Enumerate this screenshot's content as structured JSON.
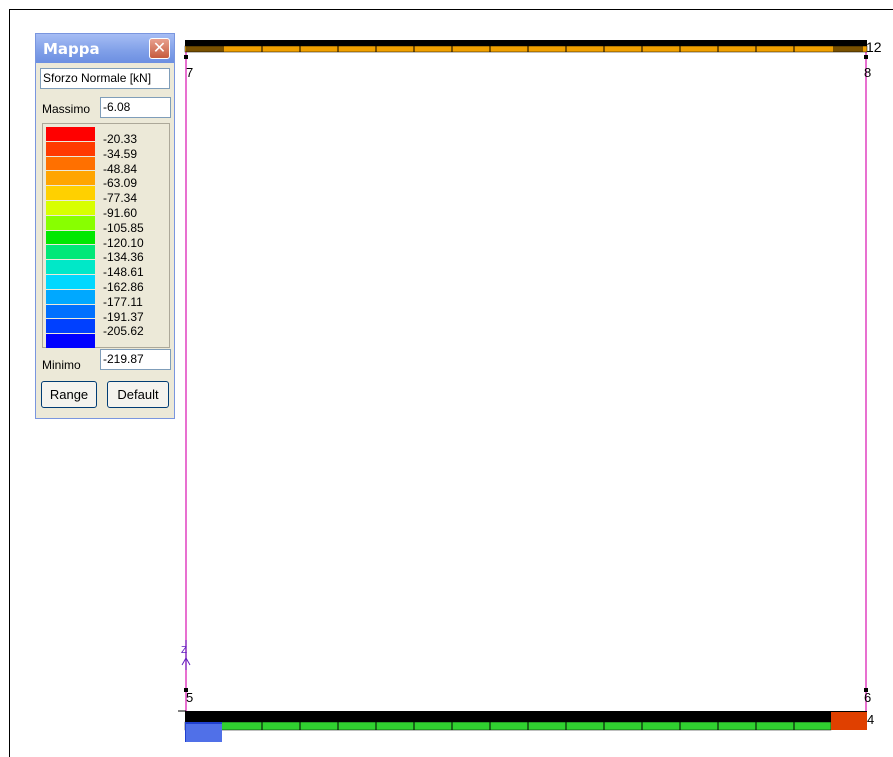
{
  "legend": {
    "title": "Mappa",
    "close_glyph": "✕",
    "quantity": "Sforzo Normale [kN]",
    "max_label": "Massimo",
    "max_value": "-6.08",
    "min_label": "Minimo",
    "min_value": "-219.87",
    "range_button": "Range",
    "default_button": "Default",
    "ticks": [
      "-20.33",
      "-34.59",
      "-48.84",
      "-63.09",
      "-77.34",
      "-91.60",
      "-105.85",
      "-120.10",
      "-134.36",
      "-148.61",
      "-162.86",
      "-177.11",
      "-191.37",
      "-205.62"
    ],
    "colors": [
      "#ff0000",
      "#ff3a00",
      "#ff7000",
      "#ffa500",
      "#ffd000",
      "#d8ff00",
      "#88ff00",
      "#00e800",
      "#00e878",
      "#00e8c8",
      "#00d8ff",
      "#00a8ff",
      "#0070ff",
      "#0040ff",
      "#0000ff"
    ]
  },
  "nodes": {
    "n7": "7",
    "n8": "8",
    "n12": "12",
    "n5": "5",
    "n6": "6",
    "n4": "4",
    "axis_z": "Z"
  },
  "colors": {
    "column": "#e040c0",
    "top_beam": "#f0a000",
    "bottom_beam": "#30d030",
    "beam_outline": "#000000"
  }
}
